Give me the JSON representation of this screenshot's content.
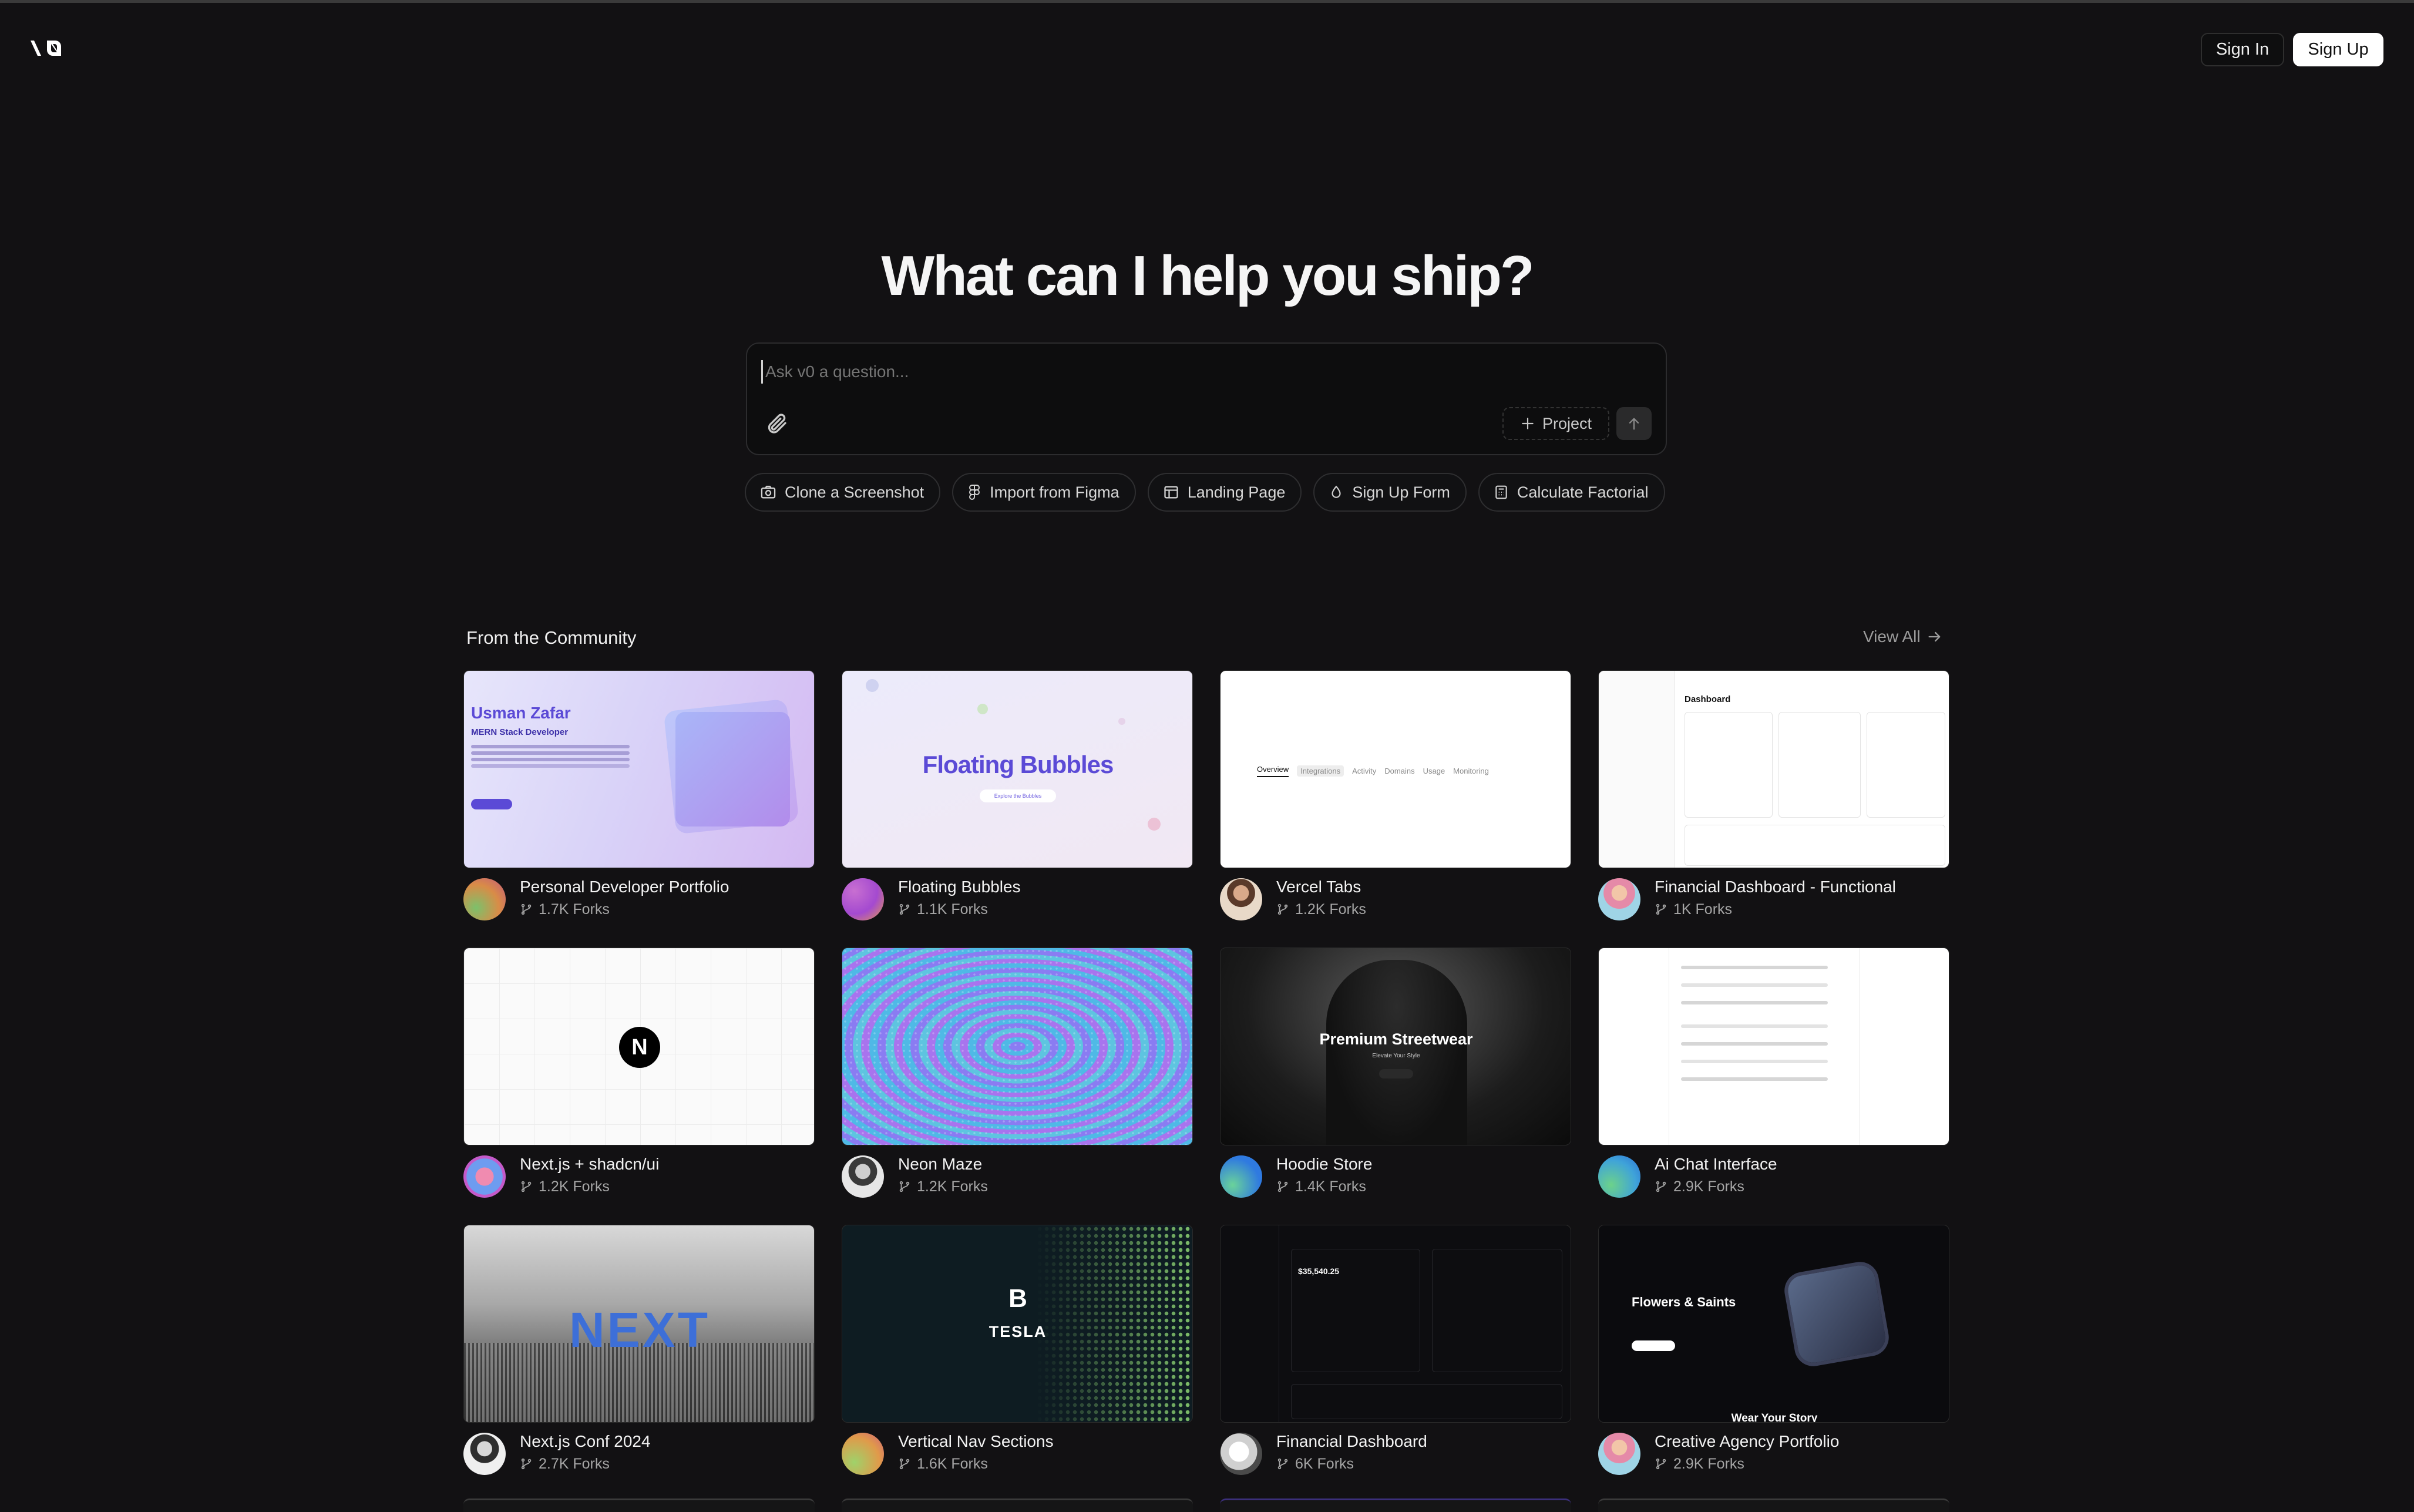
{
  "header": {
    "logo": "v0-logo",
    "signin_label": "Sign In",
    "signup_label": "Sign Up"
  },
  "hero": {
    "title": "What can I help you ship?",
    "input_placeholder": "Ask v0 a question...",
    "project_label": "Project"
  },
  "chips": [
    {
      "label": "Clone a Screenshot",
      "icon": "camera-icon"
    },
    {
      "label": "Import from Figma",
      "icon": "figma-icon"
    },
    {
      "label": "Landing Page",
      "icon": "layout-icon"
    },
    {
      "label": "Sign Up Form",
      "icon": "drop-icon"
    },
    {
      "label": "Calculate Factorial",
      "icon": "calculator-icon"
    }
  ],
  "community": {
    "title": "From the Community",
    "view_all": "View All",
    "cards": [
      {
        "title": "Personal Developer Portfolio",
        "forks": "1.7K Forks",
        "thumb_text": "Usman Zafar",
        "thumb_sub": "MERN Stack Developer"
      },
      {
        "title": "Floating Bubbles",
        "forks": "1.1K Forks",
        "thumb_text": "Floating Bubbles",
        "thumb_sub": "Explore the Bubbles"
      },
      {
        "title": "Vercel Tabs",
        "forks": "1.2K Forks",
        "thumb_tabs": [
          "Overview",
          "Integrations",
          "Activity",
          "Domains",
          "Usage",
          "Monitoring"
        ]
      },
      {
        "title": "Financial Dashboard - Functional",
        "forks": "1K Forks",
        "thumb_text": "Dashboard"
      },
      {
        "title": "Next.js + shadcn/ui",
        "forks": "1.2K Forks",
        "thumb_text": "N"
      },
      {
        "title": "Neon Maze",
        "forks": "1.2K Forks"
      },
      {
        "title": "Hoodie Store",
        "forks": "1.4K Forks",
        "thumb_text": "Premium Streetwear",
        "thumb_sub": "Elevate Your Style"
      },
      {
        "title": "Ai Chat Interface",
        "forks": "2.9K Forks"
      },
      {
        "title": "Next.js Conf 2024",
        "forks": "2.7K Forks",
        "thumb_text": "NEXT"
      },
      {
        "title": "Vertical Nav Sections",
        "forks": "1.6K Forks",
        "thumb_text": "TESLA"
      },
      {
        "title": "Financial Dashboard",
        "forks": "6K Forks",
        "thumb_text": "$35,540.25"
      },
      {
        "title": "Creative Agency Portfolio",
        "forks": "2.9K Forks",
        "thumb_text": "Flowers & Saints",
        "thumb_sub": "Wear Your Story"
      }
    ]
  }
}
